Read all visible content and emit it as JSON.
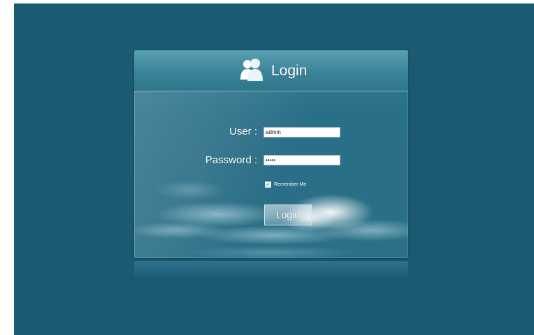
{
  "login": {
    "title": "Login",
    "header_icon": "users-icon",
    "user_label": "User :",
    "user_value": "admin",
    "password_label": "Password :",
    "password_value": "admin",
    "remember_label": "Remember Me",
    "remember_checked": true,
    "submit_label": "Login"
  },
  "colors": {
    "background": "#1b5a73",
    "panel": "#2a6f88",
    "header": "#3b8399",
    "text": "#ffffff"
  }
}
